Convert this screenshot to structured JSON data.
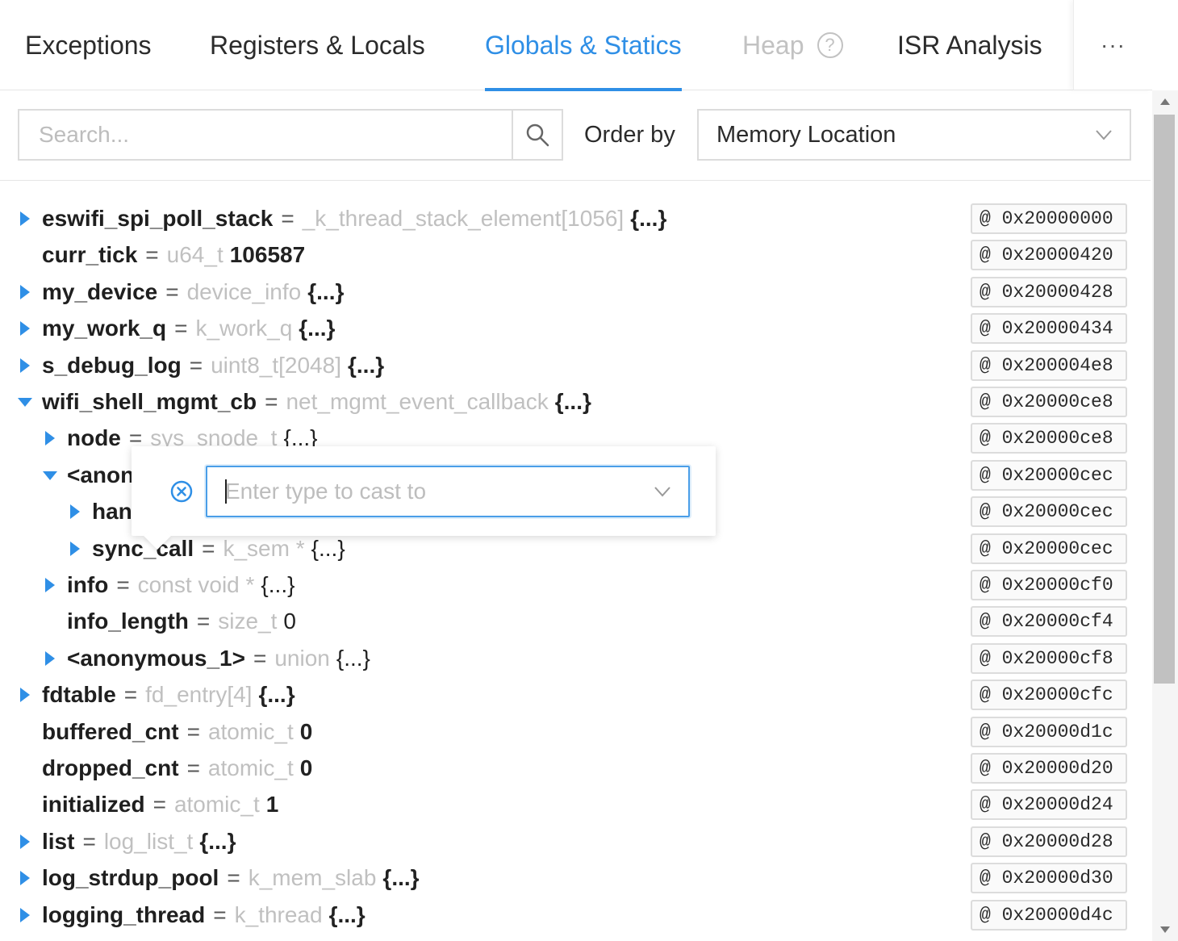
{
  "tabs": [
    {
      "label": "Exceptions",
      "state": "normal"
    },
    {
      "label": "Registers & Locals",
      "state": "normal"
    },
    {
      "label": "Globals & Statics",
      "state": "active"
    },
    {
      "label": "Heap",
      "state": "disabled"
    },
    {
      "label": "ISR Analysis",
      "state": "normal"
    }
  ],
  "more_label": "···",
  "toolbar": {
    "search_placeholder": "Search...",
    "order_by_label": "Order by",
    "order_by_value": "Memory Location"
  },
  "cast_popover": {
    "placeholder": "Enter type to cast to"
  },
  "colors": {
    "accent": "#2f8fe6",
    "caret": "#2f8fe6",
    "type_text": "#c0c0c0"
  },
  "rows": [
    {
      "name": "eswifi_spi_poll_stack",
      "type": "_k_thread_stack_element[1056]",
      "value": "{...}",
      "bold_value": true,
      "expander": "collapsed",
      "depth": 0,
      "address": "@ 0x20000000"
    },
    {
      "name": "curr_tick",
      "type": "u64_t",
      "value": "106587",
      "bold_value": true,
      "expander": "none",
      "depth": 0,
      "address": "@ 0x20000420"
    },
    {
      "name": "my_device",
      "type": "device_info",
      "value": "{...}",
      "bold_value": true,
      "expander": "collapsed",
      "depth": 0,
      "address": "@ 0x20000428"
    },
    {
      "name": "my_work_q",
      "type": "k_work_q",
      "value": "{...}",
      "bold_value": true,
      "expander": "collapsed",
      "depth": 0,
      "address": "@ 0x20000434"
    },
    {
      "name": "s_debug_log",
      "type": "uint8_t[2048]",
      "value": "{...}",
      "bold_value": true,
      "expander": "collapsed",
      "depth": 0,
      "address": "@ 0x200004e8"
    },
    {
      "name": "wifi_shell_mgmt_cb",
      "type": "net_mgmt_event_callback",
      "value": "{...}",
      "bold_value": true,
      "expander": "expanded",
      "depth": 0,
      "address": "@ 0x20000ce8"
    },
    {
      "name": "node",
      "type": "sys_snode_t",
      "value": "{...}",
      "bold_value": false,
      "expander": "collapsed",
      "depth": 1,
      "address": "@ 0x20000ce8"
    },
    {
      "name": "<anon",
      "type": "",
      "value": "",
      "bold_value": false,
      "expander": "expanded",
      "depth": 1,
      "address": "@ 0x20000cec"
    },
    {
      "name": "hanc",
      "type": "",
      "value": "",
      "bold_value": false,
      "expander": "collapsed",
      "depth": 2,
      "address": "@ 0x20000cec"
    },
    {
      "name": "sync_call",
      "type": "k_sem *",
      "value": "{...}",
      "bold_value": false,
      "expander": "collapsed",
      "depth": 2,
      "address": "@ 0x20000cec"
    },
    {
      "name": "info",
      "type": "const void *",
      "value": "{...}",
      "bold_value": false,
      "expander": "collapsed",
      "depth": 1,
      "address": "@ 0x20000cf0"
    },
    {
      "name": "info_length",
      "type": "size_t",
      "value": "0",
      "bold_value": false,
      "expander": "none",
      "depth": 1,
      "address": "@ 0x20000cf4"
    },
    {
      "name": "<anonymous_1>",
      "type": "union",
      "value": "{...}",
      "bold_value": false,
      "expander": "collapsed",
      "depth": 1,
      "address": "@ 0x20000cf8"
    },
    {
      "name": "fdtable",
      "type": "fd_entry[4]",
      "value": "{...}",
      "bold_value": true,
      "expander": "collapsed",
      "depth": 0,
      "address": "@ 0x20000cfc"
    },
    {
      "name": "buffered_cnt",
      "type": "atomic_t",
      "value": "0",
      "bold_value": true,
      "expander": "none",
      "depth": 0,
      "address": "@ 0x20000d1c"
    },
    {
      "name": "dropped_cnt",
      "type": "atomic_t",
      "value": "0",
      "bold_value": true,
      "expander": "none",
      "depth": 0,
      "address": "@ 0x20000d20"
    },
    {
      "name": "initialized",
      "type": "atomic_t",
      "value": "1",
      "bold_value": true,
      "expander": "none",
      "depth": 0,
      "address": "@ 0x20000d24"
    },
    {
      "name": "list",
      "type": "log_list_t",
      "value": "{...}",
      "bold_value": true,
      "expander": "collapsed",
      "depth": 0,
      "address": "@ 0x20000d28"
    },
    {
      "name": "log_strdup_pool",
      "type": "k_mem_slab",
      "value": "{...}",
      "bold_value": true,
      "expander": "collapsed",
      "depth": 0,
      "address": "@ 0x20000d30"
    },
    {
      "name": "logging_thread",
      "type": "k_thread",
      "value": "{...}",
      "bold_value": true,
      "expander": "collapsed",
      "depth": 0,
      "address": "@ 0x20000d4c"
    }
  ]
}
